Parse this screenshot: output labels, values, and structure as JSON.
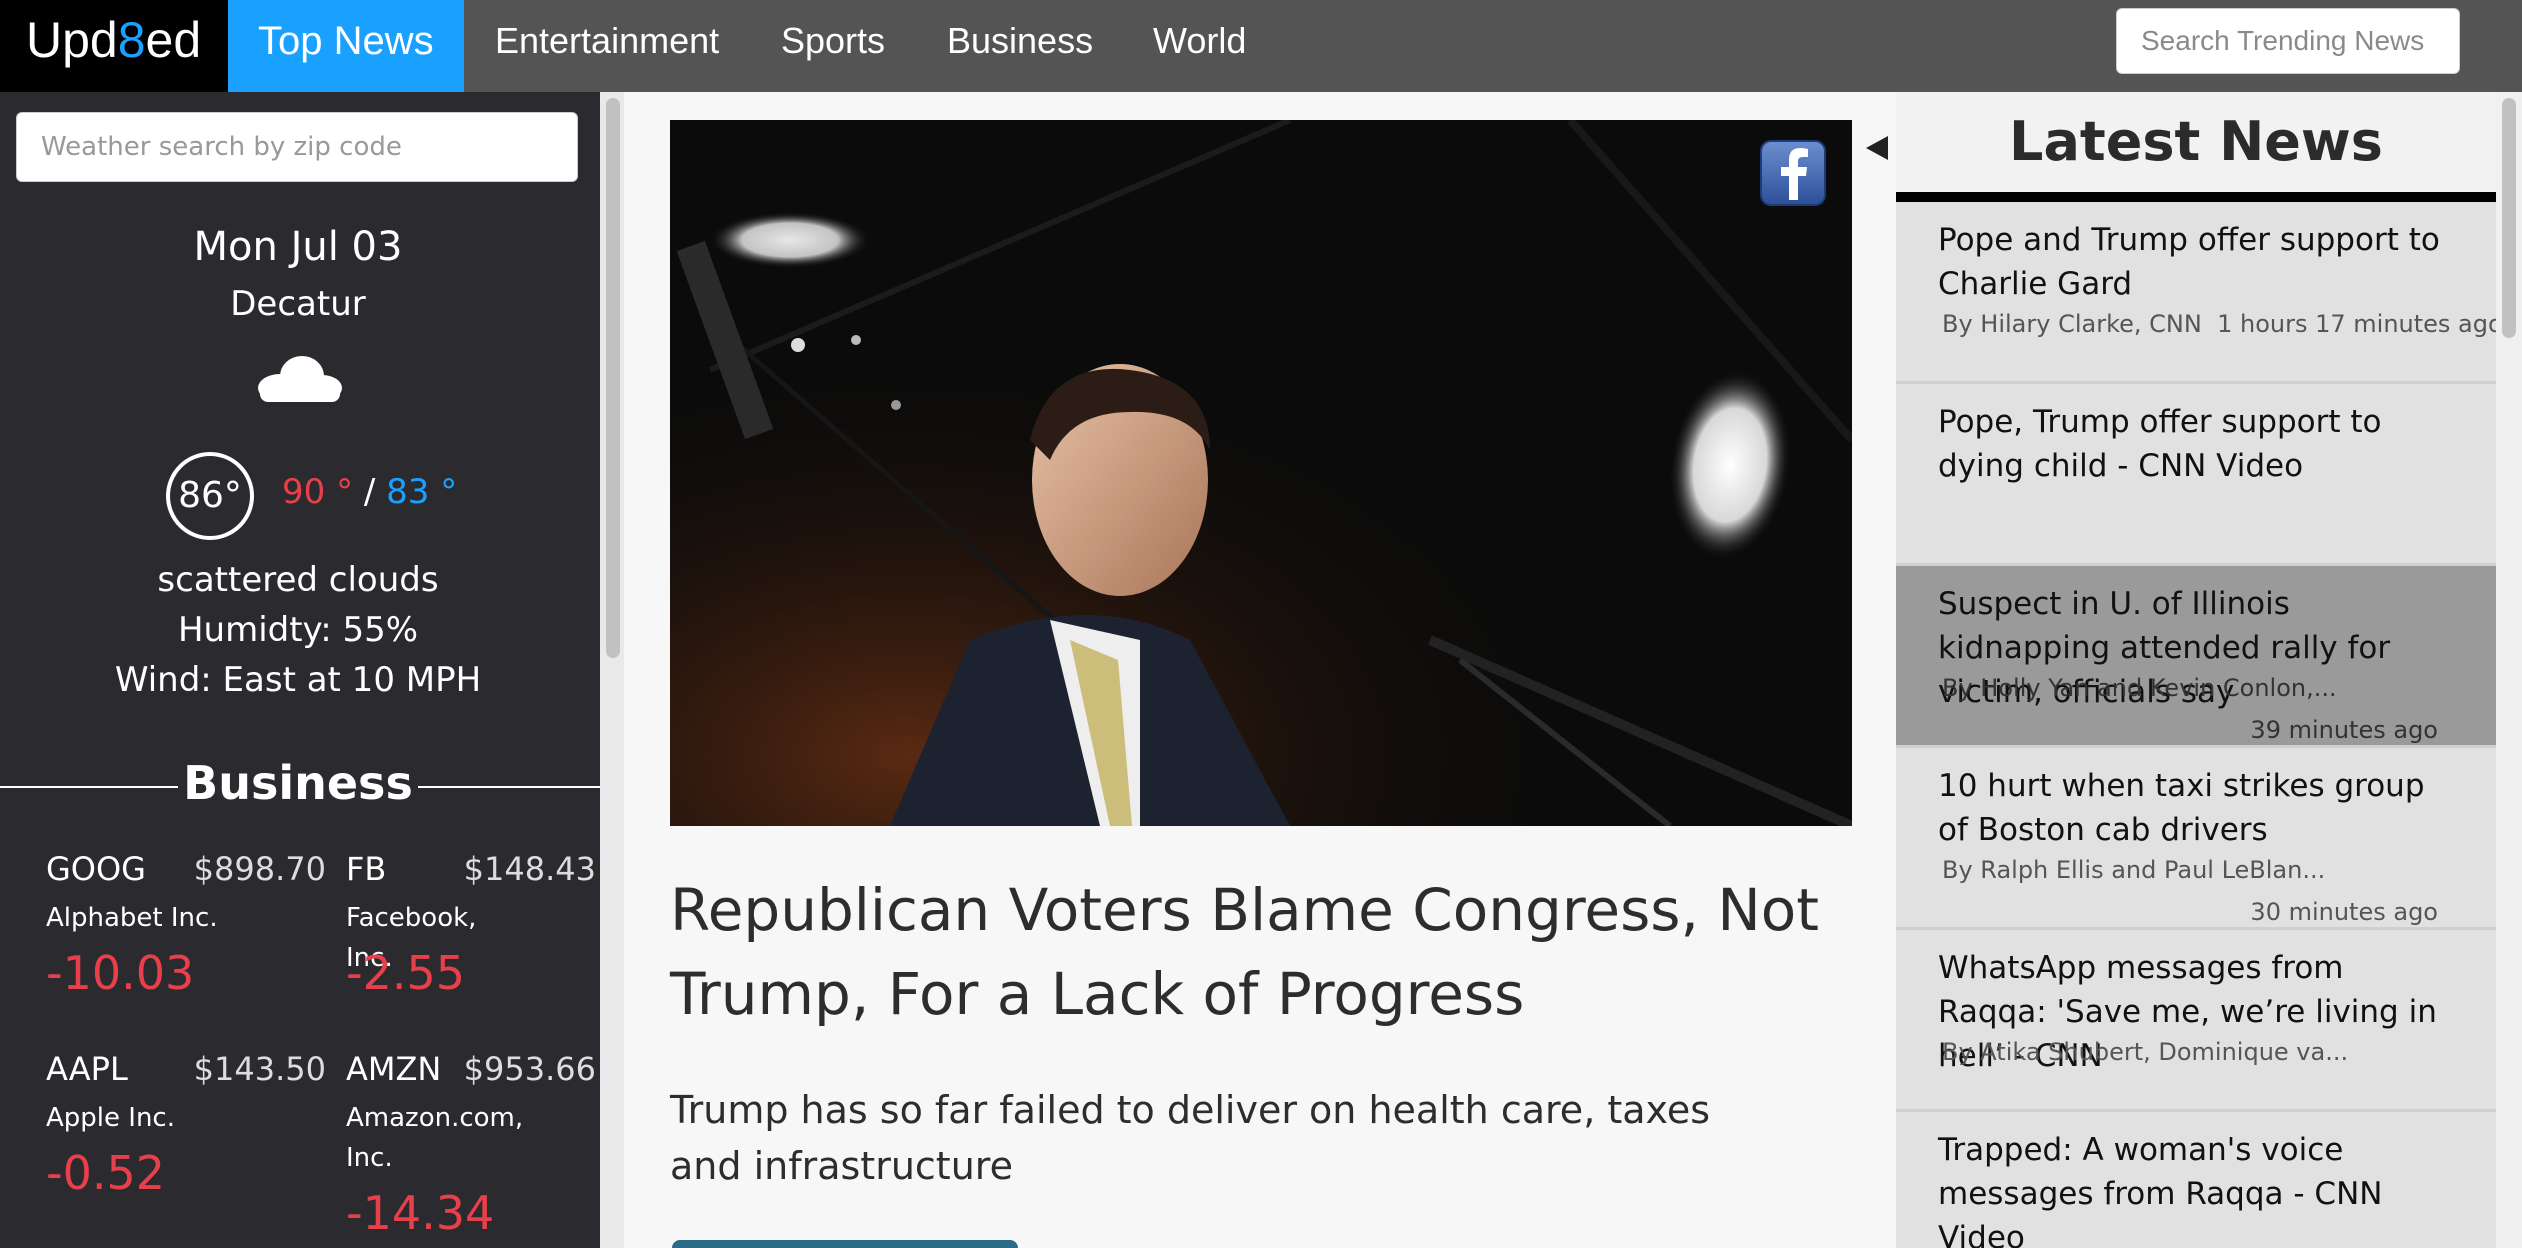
{
  "nav": {
    "brand_prefix": "Upd",
    "brand_eight": "8",
    "brand_suffix": "ed",
    "items": [
      {
        "label": "Top News"
      },
      {
        "label": "Entertainment"
      },
      {
        "label": "Sports"
      },
      {
        "label": "Business"
      },
      {
        "label": "World"
      }
    ],
    "search_placeholder": "Search Trending News"
  },
  "weather": {
    "search_placeholder": "Weather search by zip code",
    "date": "Mon Jul 03",
    "city": "Decatur",
    "icon": "cloud-icon",
    "current_temp": "86°",
    "high": "90 °",
    "low": "83 °",
    "separator": "/",
    "description": "scattered clouds",
    "humidity": "Humidty: 55%",
    "wind": "Wind: East at 10 MPH"
  },
  "business": {
    "title": "Business",
    "negative_color": "#e8404b",
    "stocks": [
      {
        "symbol": "GOOG",
        "price": "$898.70",
        "name": "Alphabet Inc.",
        "change": "-10.03"
      },
      {
        "symbol": "FB",
        "price": "$148.43",
        "name": "Facebook, Inc.",
        "change": "-2.55"
      },
      {
        "symbol": "AAPL",
        "price": "$143.50",
        "name": "Apple Inc.",
        "change": "-0.52"
      },
      {
        "symbol": "AMZN",
        "price": "$953.66",
        "name": "Amazon.com, Inc.",
        "change": "-14.34"
      }
    ]
  },
  "article": {
    "headline": "Republican Voters Blame Congress, Not Trump, For a Lack of Progress",
    "subhead": "Trump has so far failed to deliver on health care, taxes and infrastructure",
    "share_icon": "facebook-icon"
  },
  "latest": {
    "title": "Latest News",
    "items": [
      {
        "title": "Pope and Trump offer support to Charlie Gard",
        "byline": "By Hilary Clarke, CNN",
        "ago": "1 hours 17 minutes ago"
      },
      {
        "title": "Pope, Trump offer support to dying child - CNN Video",
        "byline": "",
        "ago": ""
      },
      {
        "title": "Suspect in U. of Illinois kidnapping attended rally for victim, officials say",
        "byline": "By Holly Yan and Kevin Conlon,...",
        "ago": "39 minutes ago"
      },
      {
        "title": "10 hurt when taxi strikes group of Boston cab drivers",
        "byline": "By Ralph Ellis and Paul LeBlan...",
        "ago": "30 minutes ago"
      },
      {
        "title": "WhatsApp messages from Raqqa: 'Save me, we’re living in hell’ - CNN",
        "byline": "By Atika Shubert, Dominique va...",
        "ago": ""
      },
      {
        "title": "Trapped: A woman's voice messages from Raqqa - CNN Video",
        "byline": "",
        "ago": ""
      }
    ]
  },
  "colors": {
    "accent": "#1aa0ff",
    "nav_bg": "#545454",
    "sidebar_bg": "#2b2a2f"
  }
}
